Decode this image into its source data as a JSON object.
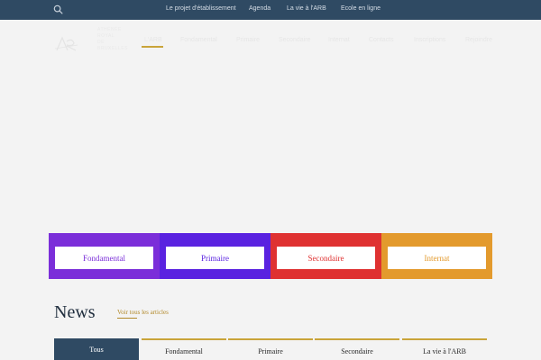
{
  "topbar": {
    "links": [
      "Le projet d'établissement",
      "Agenda",
      "La vie à l'ARB",
      "Ecole en ligne"
    ]
  },
  "logo": {
    "lines": [
      "ATHÉNÉE",
      "ROYAL",
      "DE",
      "BRUXELLES"
    ]
  },
  "mainnav": {
    "items": [
      "L'ARB",
      "Fondamental",
      "Primaire",
      "Secondaire",
      "Internat",
      "Contacts",
      "Inscriptions",
      "Rejoindre"
    ]
  },
  "categories": [
    {
      "label": "Fondamental",
      "color": "#7b2ed9",
      "text_color": "#7b2ed9"
    },
    {
      "label": "Primaire",
      "color": "#5a22e0",
      "text_color": "#5a22e0"
    },
    {
      "label": "Secondaire",
      "color": "#df3131",
      "text_color": "#df3131"
    },
    {
      "label": "Internat",
      "color": "#e39a2d",
      "text_color": "#e39a2d"
    }
  ],
  "news": {
    "title": "News",
    "see_all": "Voir tous les articles",
    "tabs": [
      "Tous",
      "Fondamental",
      "Primaire",
      "Secondaire",
      "La vie à l'ARB"
    ],
    "active_tab": "Tous"
  },
  "colors": {
    "navy": "#2f4a63",
    "gold": "#c9a43a",
    "background": "#f3f3f3"
  }
}
